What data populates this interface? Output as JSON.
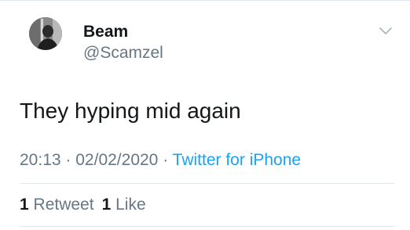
{
  "user": {
    "display_name": "Beam",
    "handle": "@Scamzel"
  },
  "tweet": {
    "text": "They hyping mid again",
    "time": "20:13",
    "separator": "·",
    "date": "02/02/2020",
    "source": "Twitter for iPhone"
  },
  "stats": {
    "retweets_count": "1",
    "retweets_label": "Retweet",
    "likes_count": "1",
    "likes_label": "Like"
  },
  "icons": {
    "menu": "chevron-down-icon"
  },
  "colors": {
    "text": "#14171a",
    "secondary": "#657786",
    "link": "#1da1f2",
    "divider": "#e1e8ed"
  }
}
